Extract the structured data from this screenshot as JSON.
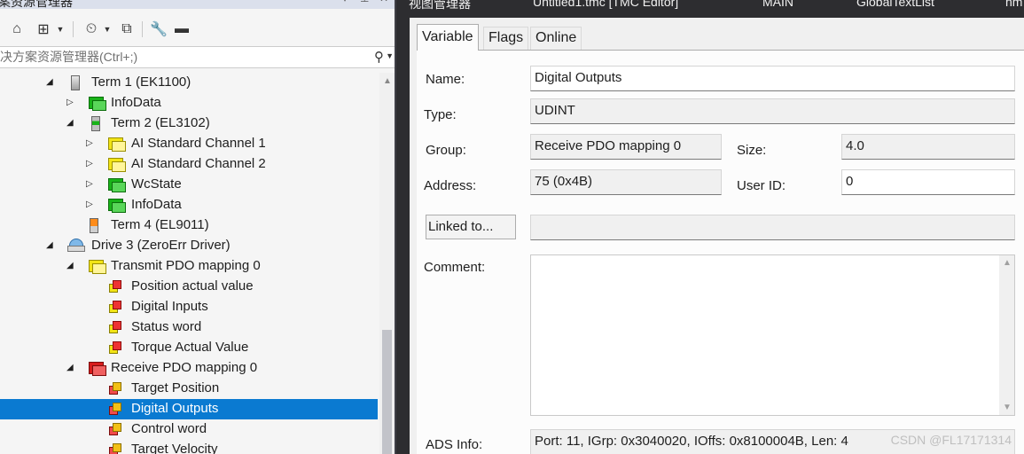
{
  "explorer": {
    "title": "案资源管理器",
    "title_pin": "▾ ⊥",
    "search_placeholder": "决方案资源管理器(Ctrl+;)",
    "tree": [
      {
        "label": "Term 1 (EK1100)",
        "arrow": "◢",
        "icon": "terminal-icon"
      },
      {
        "label": "InfoData",
        "arrow": "▷",
        "icon": "input-variable-group-icon"
      },
      {
        "label": "Term 2 (EL3102)",
        "arrow": "◢",
        "icon": "terminal-icon"
      },
      {
        "label": "AI Standard Channel 1",
        "arrow": "▷",
        "icon": "input-channel-icon"
      },
      {
        "label": "AI Standard Channel 2",
        "arrow": "▷",
        "icon": "input-channel-icon"
      },
      {
        "label": "WcState",
        "arrow": "▷",
        "icon": "input-variable-group-icon"
      },
      {
        "label": "InfoData",
        "arrow": "▷",
        "icon": "input-variable-group-icon"
      },
      {
        "label": "Term 4 (EL9011)",
        "arrow": "",
        "icon": "end-terminal-icon"
      },
      {
        "label": "Drive 3 (ZeroErr Driver)",
        "arrow": "◢",
        "icon": "drive-icon"
      },
      {
        "label": "Transmit PDO mapping 0",
        "arrow": "◢",
        "icon": "input-pdo-icon"
      },
      {
        "label": "Position actual value",
        "arrow": "",
        "icon": "input-variable-icon"
      },
      {
        "label": "Digital Inputs",
        "arrow": "",
        "icon": "input-variable-icon"
      },
      {
        "label": "Status word",
        "arrow": "",
        "icon": "input-variable-icon"
      },
      {
        "label": "Torque Actual Value",
        "arrow": "",
        "icon": "input-variable-icon"
      },
      {
        "label": "Receive PDO mapping 0",
        "arrow": "◢",
        "icon": "output-pdo-icon"
      },
      {
        "label": "Target Position",
        "arrow": "",
        "icon": "output-variable-icon"
      },
      {
        "label": "Digital Outputs",
        "arrow": "",
        "icon": "output-variable-icon"
      },
      {
        "label": "Control word",
        "arrow": "",
        "icon": "output-variable-icon"
      },
      {
        "label": "Target Velocity",
        "arrow": "",
        "icon": "output-variable-icon"
      }
    ]
  },
  "doc_tabs": [
    "视图管理器",
    "Untitled1.tmc [TMC Editor]",
    "MAIN",
    "GlobalTextList",
    "hm"
  ],
  "editor": {
    "tabs": [
      "Variable",
      "Flags",
      "Online"
    ],
    "labels": {
      "name": "Name:",
      "type": "Type:",
      "group": "Group:",
      "size": "Size:",
      "address": "Address:",
      "user_id": "User ID:",
      "comment": "Comment:",
      "ads_info": "ADS Info:"
    },
    "values": {
      "name": "Digital Outputs",
      "type": "UDINT",
      "group": "Receive PDO mapping 0",
      "size": "4.0",
      "address": "75 (0x4B)",
      "user_id": "0",
      "linked": "",
      "comment": "",
      "ads_info": "Port: 11, IGrp: 0x3040020, IOffs: 0x8100004B, Len: 4"
    },
    "linked_button": "Linked to..."
  },
  "watermark": "CSDN @FL17171314",
  "colors": {
    "selection": "#0a7ad1",
    "ide_dark": "#2d2d30",
    "panel": "#f5f5f5"
  }
}
